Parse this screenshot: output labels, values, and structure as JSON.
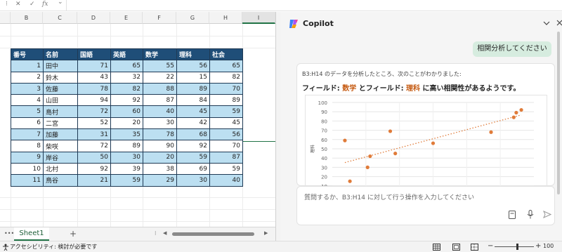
{
  "formula_bar": {
    "dots": "⁝",
    "cancel": "✕",
    "confirm": "✓",
    "fx": "fx",
    "chevron": "⌄"
  },
  "sheet": {
    "columns": [
      "B",
      "C",
      "D",
      "E",
      "F",
      "G",
      "H",
      "I"
    ],
    "table": {
      "headers": [
        "番号",
        "名前",
        "国語",
        "英語",
        "数学",
        "理科",
        "社会"
      ],
      "rows": [
        [
          1,
          "田中",
          71,
          65,
          55,
          56,
          65
        ],
        [
          2,
          "鈴木",
          43,
          32,
          22,
          15,
          82
        ],
        [
          3,
          "佐藤",
          78,
          82,
          88,
          89,
          70
        ],
        [
          4,
          "山田",
          94,
          92,
          87,
          84,
          89
        ],
        [
          5,
          "島村",
          72,
          60,
          40,
          45,
          59
        ],
        [
          6,
          "二宮",
          52,
          20,
          30,
          42,
          45
        ],
        [
          7,
          "加藤",
          31,
          35,
          78,
          68,
          56
        ],
        [
          8,
          "柴咲",
          72,
          89,
          90,
          92,
          70
        ],
        [
          9,
          "岸谷",
          50,
          30,
          20,
          59,
          87
        ],
        [
          10,
          "北村",
          92,
          39,
          38,
          69,
          59
        ],
        [
          11,
          "鳥谷",
          21,
          59,
          29,
          30,
          40
        ]
      ]
    },
    "tabs": {
      "more": "•••",
      "active": "Sheet1",
      "add": "+"
    },
    "status": {
      "accessibility": "アクセシビリティ: 検討が必要です",
      "zoom": "100"
    }
  },
  "copilot": {
    "title": "Copilot",
    "user_message": "相関分析してください",
    "response_intro": "B3:H14 のデータを分析したところ、次のことがわかりました:",
    "finding": {
      "part1": "フィールド: ",
      "field1": "数学",
      "part2": " とフィールド: ",
      "field2": "理科",
      "part3": " に高い相関性があるようです。"
    },
    "input_placeholder": "質問するか、B3:H14 に対して行う操作を入力してください",
    "colors": {
      "accent": "#c55a11",
      "point": "#e07b39",
      "bubble": "#d6ecdf",
      "header": "#1f4e78",
      "band": "#bcdff1"
    }
  },
  "chart_data": {
    "type": "scatter",
    "yticks": [
      10,
      20,
      30,
      40,
      50,
      60,
      70,
      80,
      90,
      100
    ],
    "ylabel": "理科",
    "ylim": [
      10,
      100
    ],
    "xlim": [
      15,
      95
    ],
    "x": [
      55,
      22,
      88,
      87,
      40,
      30,
      78,
      90,
      20,
      38,
      29
    ],
    "y": [
      56,
      15,
      89,
      84,
      45,
      42,
      68,
      92,
      59,
      69,
      30
    ],
    "trendline": "linear",
    "grid": true
  }
}
